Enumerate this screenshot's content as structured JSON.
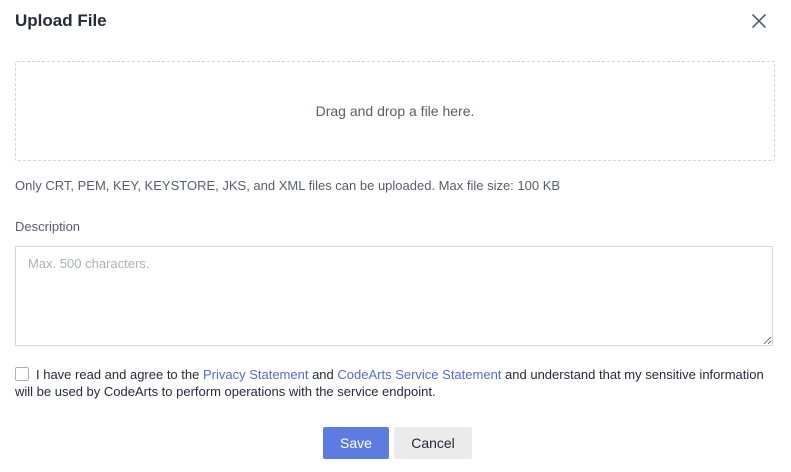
{
  "dialog": {
    "title": "Upload File"
  },
  "dropzone": {
    "text": "Drag and drop a file here."
  },
  "hint": "Only CRT, PEM, KEY, KEYSTORE, JKS, and XML files can be uploaded. Max file size: 100 KB",
  "description": {
    "label": "Description",
    "value": "",
    "placeholder": "Max. 500 characters."
  },
  "agreement": {
    "checked": false,
    "prefix": "I have read and agree to the ",
    "privacy_link": "Privacy Statement",
    "middle": " and ",
    "service_link": "CodeArts Service Statement",
    "suffix": " and understand that my sensitive information will be used by CodeArts to perform operations with the service endpoint."
  },
  "buttons": {
    "save": "Save",
    "cancel": "Cancel"
  },
  "colors": {
    "primary": "#5e7ce0",
    "link": "#526ecc",
    "text": "#252b3a",
    "muted": "#575d6c",
    "placeholder": "#adb0b8",
    "border": "#d3d5da"
  },
  "icons": {
    "close": "close-icon"
  }
}
